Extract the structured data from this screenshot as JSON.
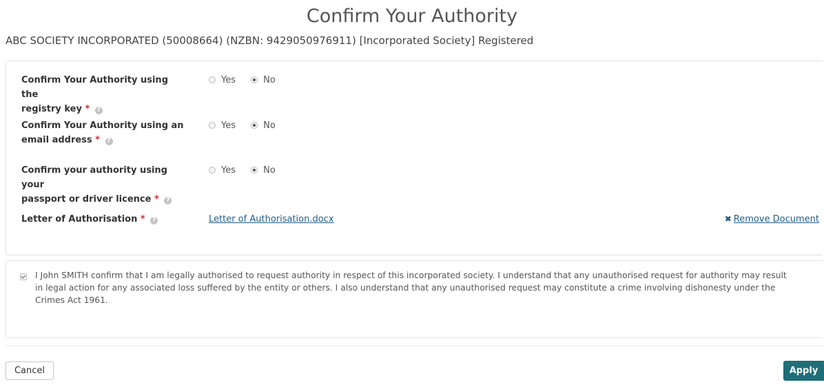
{
  "page": {
    "title": "Confirm Your Authority",
    "entity_line": "ABC SOCIETY INCORPORATED (50008664) (NZBN: 9429050976911) [Incorporated Society] Registered"
  },
  "form": {
    "required_marker": "*",
    "help_icon": "help-icon",
    "yes_label": "Yes",
    "no_label": "No",
    "rows": [
      {
        "label_line1": "Confirm Your Authority using the",
        "label_line2": "registry key",
        "selected": "No"
      },
      {
        "label_line1": "Confirm Your Authority using an",
        "label_line2": "email address",
        "selected": "No"
      },
      {
        "label_line1": "Confirm your authority using your",
        "label_line2": "passport or driver licence",
        "selected": "No"
      }
    ],
    "letter": {
      "label": "Letter of Authorisation",
      "file_name": "Letter of Authorisation.docx",
      "remove_label": "Remove Document",
      "remove_icon": "close-icon"
    }
  },
  "declaration": {
    "checked": true,
    "text": "I John SMITH confirm that I am legally authorised to request authority in respect of this incorporated society. I understand that any unauthorised request for authority may result in legal action for any associated loss suffered by the entity or others. I also understand that any unauthorised request may constitute a crime involving dishonesty under the Crimes Act 1961."
  },
  "actions": {
    "cancel_label": "Cancel",
    "apply_label": "Apply",
    "apply_color": "#1f6e78"
  }
}
